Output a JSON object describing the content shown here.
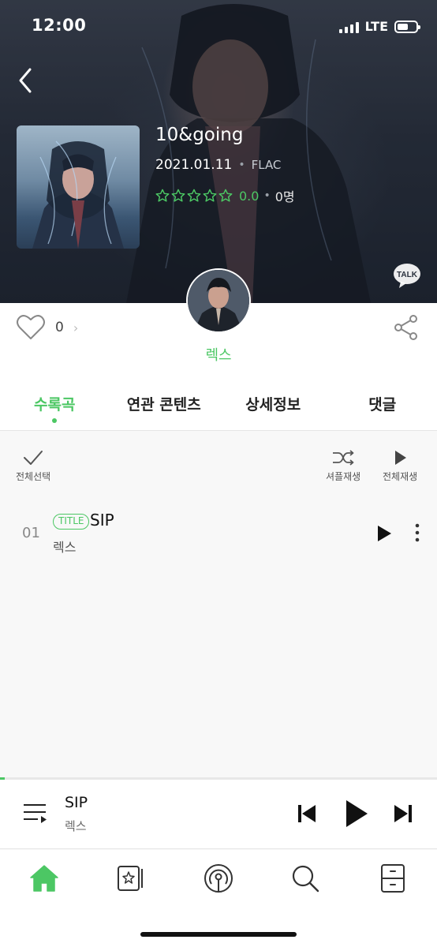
{
  "status_bar": {
    "time": "12:00",
    "network": "LTE"
  },
  "album": {
    "title": "10&going",
    "release_date": "2021.01.11",
    "format": "FLAC",
    "rating_score": "0.0",
    "rating_count": "0명",
    "stars_filled": 0,
    "stars_total": 5
  },
  "actions": {
    "like_count": "0",
    "like_chevron": "›"
  },
  "artist": {
    "name": "렉스"
  },
  "tabs": [
    {
      "label": "수록곡",
      "active": true
    },
    {
      "label": "연관 콘텐츠",
      "active": false
    },
    {
      "label": "상세정보",
      "active": false
    },
    {
      "label": "댓글",
      "active": false
    }
  ],
  "toolbar": {
    "select_all": "전체선택",
    "shuffle_play": "셔플재생",
    "play_all": "전체재생"
  },
  "tracks": [
    {
      "number": "01",
      "badge": "TITLE",
      "title": "SIP",
      "artist": "렉스"
    }
  ],
  "mini_player": {
    "title": "SIP",
    "artist": "렉스",
    "progress": 0.01
  },
  "bottom_nav": [
    "home-icon",
    "favorites-icon",
    "podcast-icon",
    "search-icon",
    "library-icon"
  ],
  "colors": {
    "accent": "#4cc764",
    "hero_dark": "#2a313d"
  }
}
